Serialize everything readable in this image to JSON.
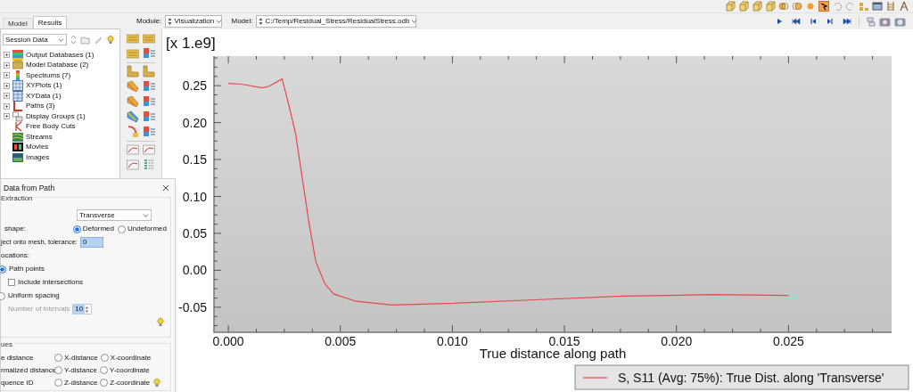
{
  "left_panel": {
    "tabs": [
      {
        "label": "Model",
        "selected": false
      },
      {
        "label": "Results",
        "selected": true
      }
    ],
    "session_dropdown": {
      "value": "Session Data"
    },
    "tree": [
      {
        "label": "Output Databases (1)",
        "collapsed": true
      },
      {
        "label": "Model Database (2)",
        "collapsed": true
      },
      {
        "label": "Spectrums (7)",
        "collapsed": true
      },
      {
        "label": "XYPlots (1)",
        "collapsed": true
      },
      {
        "label": "XYData (1)",
        "collapsed": true
      },
      {
        "label": "Paths (3)",
        "collapsed": true
      },
      {
        "label": "Display Groups (1)",
        "collapsed": true
      },
      {
        "label": "Free Body Cuts",
        "collapsed": false
      },
      {
        "label": "Streams",
        "collapsed": false
      },
      {
        "label": "Movies",
        "collapsed": false
      },
      {
        "label": "Images",
        "collapsed": false
      }
    ]
  },
  "context_bar": {
    "module_label": "Module:",
    "module_value": "Visualization",
    "model_label": "Model:",
    "model_value": "C:/Temp/Residual_Stress/ResidualStress.odb"
  },
  "viewport": {
    "scale_label": "[x 1.e9]",
    "chart_data": {
      "type": "line",
      "xlabel": "True distance along path",
      "x": [
        0,
        0.0006,
        0.0015,
        0.0018,
        0.0024,
        0.0027,
        0.003,
        0.0033,
        0.0036,
        0.0039,
        0.0043,
        0.0047,
        0.0057,
        0.0073,
        0.0097,
        0.0137,
        0.0176,
        0.0216,
        0.025
      ],
      "series": [
        {
          "name": "S, S11 (Avg: 75%): True Dist. along 'Transverse'",
          "color": "#e8474c",
          "values": [
            0.253,
            0.252,
            0.247,
            0.249,
            0.259,
            0.224,
            0.185,
            0.125,
            0.064,
            0.012,
            -0.018,
            -0.032,
            -0.042,
            -0.047,
            -0.045,
            -0.04,
            -0.035,
            -0.033,
            -0.034
          ]
        }
      ],
      "xlim": [
        -0.00064,
        0.0296
      ],
      "ylim": [
        -0.084,
        0.29
      ],
      "xticks": [
        {
          "value": 0,
          "label": "0.000"
        },
        {
          "value": 0.005,
          "label": "0.005"
        },
        {
          "value": 0.01,
          "label": "0.010"
        },
        {
          "value": 0.015,
          "label": "0.015"
        },
        {
          "value": 0.02,
          "label": "0.020"
        },
        {
          "value": 0.025,
          "label": "0.025"
        }
      ],
      "yticks": [
        {
          "value": -0.05,
          "label": "-0.05"
        },
        {
          "value": 0,
          "label": "0.00"
        },
        {
          "value": 0.05,
          "label": "0.05"
        },
        {
          "value": 0.1,
          "label": "0.10"
        },
        {
          "value": 0.15,
          "label": "0.15"
        },
        {
          "value": 0.2,
          "label": "0.20"
        },
        {
          "value": 0.25,
          "label": "0.25"
        }
      ]
    }
  },
  "dialog": {
    "title": "Data from Path",
    "extraction": {
      "heading": "Extraction",
      "path_value": "Transverse",
      "shape_label": "shape:",
      "shape_options": [
        {
          "label": "Deformed",
          "selected": true
        },
        {
          "label": "Undeformed",
          "selected": false
        }
      ],
      "tolerance_label": "ject onto mesh, tolerance:",
      "tolerance_value": "0",
      "locations_label": "ocations:",
      "path_points": {
        "label": "Path points",
        "selected": true
      },
      "include_intersections": {
        "label": "Include intersections",
        "checked": false
      },
      "uniform_spacing": {
        "label": "Uniform spacing",
        "selected": false
      },
      "intervals": {
        "label": "Number of intervals",
        "value": "10",
        "disabled": true
      }
    },
    "values": {
      "heading": "ues",
      "rows": [
        {
          "label": "e distance",
          "options": [
            {
              "label": "X-distance",
              "selected": false
            },
            {
              "label": "X-coordinate",
              "selected": false
            }
          ]
        },
        {
          "label": "rmalized distance",
          "options": [
            {
              "label": "Y-distance",
              "selected": false
            },
            {
              "label": "Y-coordinate",
              "selected": false
            }
          ]
        },
        {
          "label": "quence ID",
          "options": [
            {
              "label": "Z-distance",
              "selected": false
            },
            {
              "label": "Z-coordinate",
              "selected": false
            }
          ]
        }
      ]
    }
  }
}
